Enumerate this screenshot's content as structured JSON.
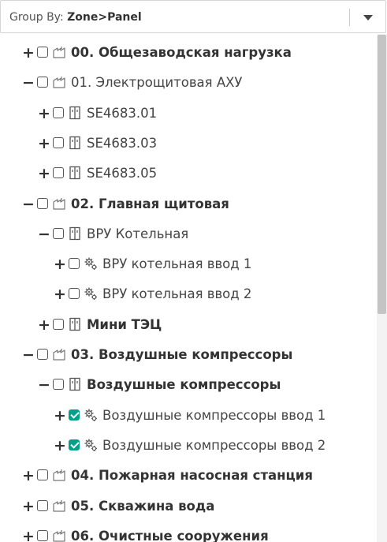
{
  "header": {
    "label": "Group By:",
    "value": "Zone>Panel"
  },
  "tree": [
    {
      "level": 0,
      "toggle": "+",
      "icon": "zone-icon",
      "checked": false,
      "bold": true,
      "label": "00. Общезаводская нагрузка"
    },
    {
      "level": 0,
      "toggle": "−",
      "icon": "zone-icon",
      "checked": false,
      "bold": false,
      "label": "01. Электрощитовая АХУ"
    },
    {
      "level": 1,
      "toggle": "+",
      "icon": "panel-icon",
      "checked": false,
      "bold": false,
      "label": "SE4683.01"
    },
    {
      "level": 1,
      "toggle": "+",
      "icon": "panel-icon",
      "checked": false,
      "bold": false,
      "label": "SE4683.03"
    },
    {
      "level": 1,
      "toggle": "+",
      "icon": "panel-icon",
      "checked": false,
      "bold": false,
      "label": "SE4683.05"
    },
    {
      "level": 0,
      "toggle": "−",
      "icon": "zone-icon",
      "checked": false,
      "bold": true,
      "label": "02. Главная щитовая"
    },
    {
      "level": 1,
      "toggle": "−",
      "icon": "panel-icon",
      "checked": false,
      "bold": false,
      "label": "ВРУ Котельная"
    },
    {
      "level": 2,
      "toggle": "+",
      "icon": "device-icon",
      "checked": false,
      "bold": false,
      "label": "ВРУ котельная ввод 1"
    },
    {
      "level": 2,
      "toggle": "+",
      "icon": "device-icon",
      "checked": false,
      "bold": false,
      "label": "ВРУ котельная ввод 2"
    },
    {
      "level": 1,
      "toggle": "+",
      "icon": "panel-icon",
      "checked": false,
      "bold": true,
      "label": "Мини ТЭЦ"
    },
    {
      "level": 0,
      "toggle": "−",
      "icon": "zone-icon",
      "checked": false,
      "bold": true,
      "label": "03. Воздушные компрессоры"
    },
    {
      "level": 1,
      "toggle": "−",
      "icon": "panel-icon",
      "checked": false,
      "bold": true,
      "label": "Воздушные компрессоры"
    },
    {
      "level": 2,
      "toggle": "+",
      "icon": "device-icon",
      "checked": true,
      "bold": false,
      "label": "Воздушные компрессоры ввод 1"
    },
    {
      "level": 2,
      "toggle": "+",
      "icon": "device-icon",
      "checked": true,
      "bold": false,
      "label": "Воздушные компрессоры ввод 2"
    },
    {
      "level": 0,
      "toggle": "+",
      "icon": "zone-icon",
      "checked": false,
      "bold": true,
      "label": "04. Пожарная насосная станция"
    },
    {
      "level": 0,
      "toggle": "+",
      "icon": "zone-icon",
      "checked": false,
      "bold": true,
      "label": "05. Скважина вода"
    },
    {
      "level": 0,
      "toggle": "+",
      "icon": "zone-icon",
      "checked": false,
      "bold": true,
      "label": "06. Очистные сооружения"
    }
  ],
  "colors": {
    "accent": "#00a08a"
  }
}
